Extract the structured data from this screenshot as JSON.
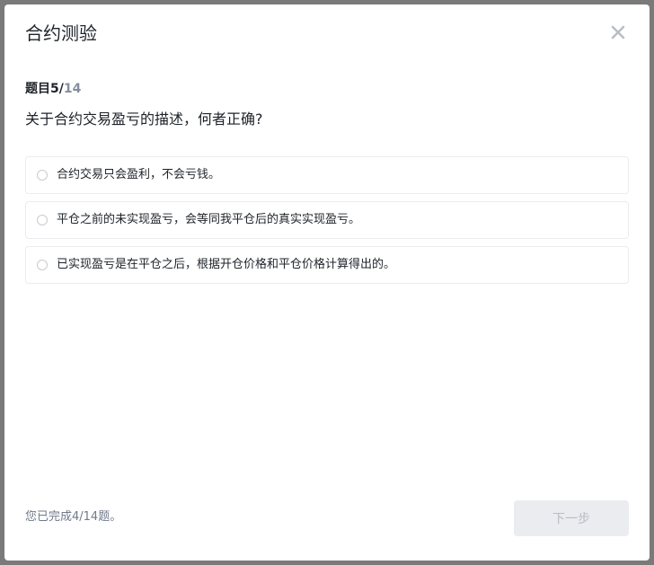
{
  "modal": {
    "title": "合约测验",
    "close_icon": "close-icon"
  },
  "progress": {
    "label": "题目",
    "current": "5/",
    "total": "14"
  },
  "question": {
    "text": "关于合约交易盈亏的描述，何者正确?"
  },
  "options": [
    {
      "label": "合约交易只会盈利，不会亏钱。",
      "selected": false
    },
    {
      "label": "平仓之前的未实现盈亏，会等同我平仓后的真实实现盈亏。",
      "selected": false
    },
    {
      "label": "已实现盈亏是在平仓之后，根据开仓价格和平仓价格计算得出的。",
      "selected": false
    }
  ],
  "footer": {
    "status": "您已完成4/14题。",
    "next_label": "下一步",
    "next_enabled": false
  },
  "colors": {
    "text_primary": "#1e2329",
    "text_secondary": "#848e9c",
    "disabled_bg": "#eaecef",
    "disabled_text": "#b7bdc6"
  }
}
